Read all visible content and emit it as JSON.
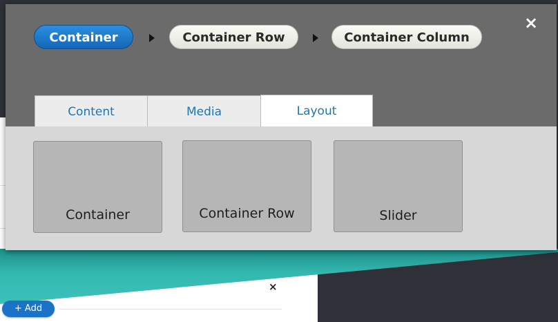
{
  "breadcrumb": {
    "items": [
      {
        "label": "Container",
        "active": true
      },
      {
        "label": "Container Row",
        "active": false
      },
      {
        "label": "Container Column",
        "active": false
      }
    ],
    "separator_icon": "triangle-right-icon"
  },
  "modal": {
    "close_label": "×"
  },
  "tabs": [
    {
      "label": "Content",
      "active": false
    },
    {
      "label": "Media",
      "active": false
    },
    {
      "label": "Layout",
      "active": true
    }
  ],
  "tiles": [
    {
      "label": "Container"
    },
    {
      "label": "Container Row"
    },
    {
      "label": "Slider"
    }
  ],
  "background": {
    "add_button_label": "+ Add",
    "close_label": "×"
  },
  "colors": {
    "accent_blue": "#1a73c7",
    "header_gray": "#6b6b6b",
    "body_gray": "#d7d7d7",
    "teal": "#3cc2ba",
    "tab_text": "#1f76b3"
  }
}
